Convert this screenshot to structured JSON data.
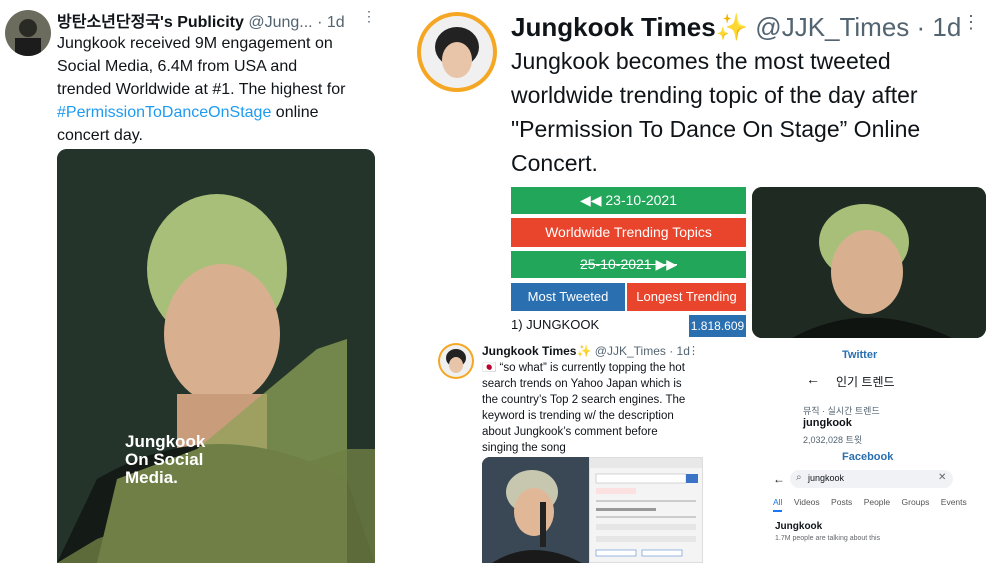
{
  "tweet1": {
    "name": "방탄소년단정국's Publicity",
    "handle": "@Jung...",
    "time": "· 1d",
    "text_lines": [
      "Jungkook received 9M engagement on",
      "Social Media, 6.4M from USA and",
      "trended Worldwide at #1. The highest for"
    ],
    "hashtag": "#PermissionToDanceOnStage",
    "text_after_hashtag": " online",
    "text_last": "concert day.",
    "image_caption": [
      "Jungkook",
      "On Social",
      "Media."
    ]
  },
  "tweet2": {
    "name": "Jungkook Times",
    "sparkle": "✨",
    "handle": "@JJK_Times",
    "time": "· 1d",
    "text_lines": [
      "Jungkook becomes the most tweeted",
      "worldwide trending topic of the day after",
      "\"Permission To Dance On Stage” Online",
      "Concert."
    ],
    "stats": {
      "date_top": "◀◀ 23-10-2021",
      "title": "Worldwide Trending Topics",
      "date_bottom": "25-10-2021 ▶▶",
      "tab_left": "Most Tweeted",
      "tab_right": "Longest Trending",
      "rank_label": "1) JUNGKOOK",
      "rank_value": "1.818.609"
    }
  },
  "tweet3": {
    "name": "Jungkook Times",
    "sparkle": "✨",
    "handle": "@JJK_Times",
    "time": "· 1d",
    "text_lines": [
      "“so what” is currently topping the hot",
      "search trends on Yahoo Japan which is",
      "the country’s Top 2 search engines. The",
      "keyword is trending w/ the description",
      "about Jungkook’s comment before",
      "singing the song"
    ],
    "flag": "🇯🇵"
  },
  "twitter_panel": {
    "brand": "Twitter",
    "back": "←",
    "title": "인기 트렌드",
    "category": "뮤직 · 실시간 트렌드",
    "trend": "jungkook",
    "count": "2,032,028 트윗"
  },
  "facebook_panel": {
    "brand": "Facebook",
    "back": "←",
    "search_value": "jungkook",
    "tabs": [
      "All",
      "Videos",
      "Posts",
      "People",
      "Groups",
      "Events"
    ],
    "result_title": "Jungkook",
    "result_sub": "1.7M people are talking about this"
  },
  "colors": {
    "green": "#22a65a",
    "red": "#e8452c",
    "blue": "#2a6fb0",
    "link": "#1d9bf0"
  }
}
